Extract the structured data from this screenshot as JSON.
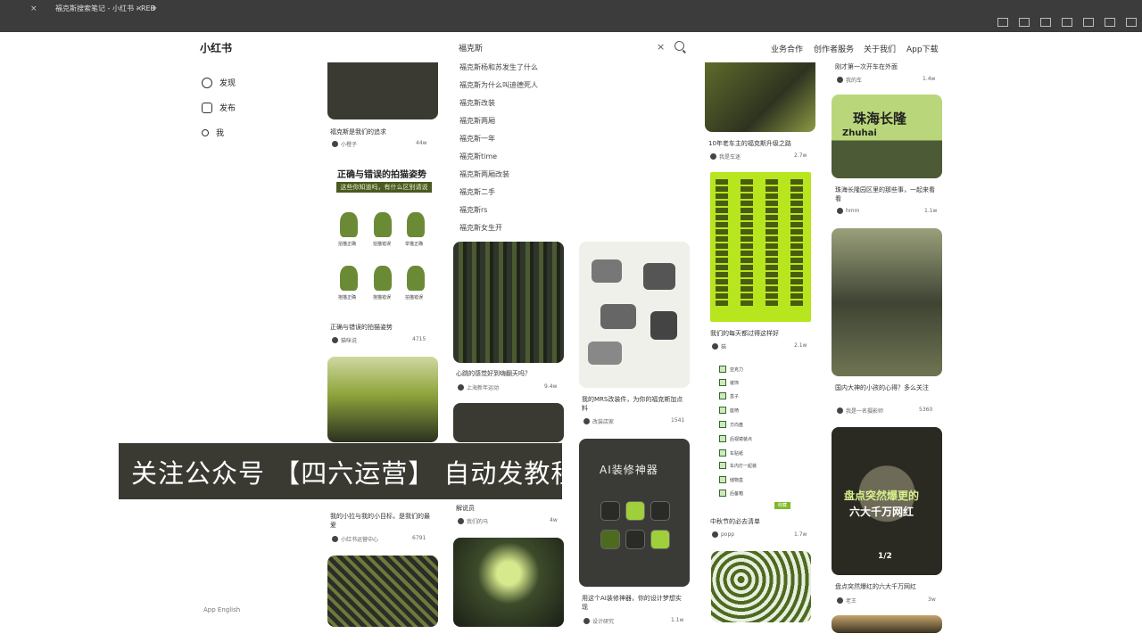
{
  "browser": {
    "tabs": [
      {
        "label": "福克斯搜索笔记 - 小红书 - RED"
      }
    ],
    "new_tab": "+",
    "tab_close": "×"
  },
  "header": {
    "logo": "小红书",
    "search_value": "福克斯",
    "search_clear": "×",
    "nav": [
      "业务合作",
      "创作者服务",
      "关于我们",
      "App下载"
    ]
  },
  "sidebar": {
    "items": [
      {
        "label": "发现",
        "icon": "compass-icon"
      },
      {
        "label": "发布",
        "icon": "plus-square-icon"
      },
      {
        "label": "我",
        "icon": "user-icon"
      }
    ],
    "footer": "App  English"
  },
  "suggestions": [
    "福克斯杨和苏发生了什么",
    "福克斯为什么叫迪德死人",
    "福克斯改装",
    "福克斯两厢",
    "福克斯一年",
    "福克斯time",
    "福克斯两厢改装",
    "福克斯二手",
    "福克斯rs",
    "福克斯女生开"
  ],
  "cards": {
    "c1": {
      "caption": "福克斯是我们的追求",
      "author": "小橙子",
      "likes": "44w"
    },
    "c2": {
      "caption": "正确与错误的拍猫姿势",
      "author": "猫咪说",
      "likes": "4715",
      "title": "正确与错误的拍猫姿势",
      "subtitle": "这些你知道吗，有什么区别请说"
    },
    "c3": {
      "caption": "我的小拉与我的小目标，是我们的最爱",
      "author": "小红书运营中心",
      "likes": "6791"
    },
    "c4": {
      "caption": "心跳的感觉好到嗨翻天吗？",
      "author": "上海新年运动",
      "likes": "9.4w"
    },
    "c5": {
      "caption": "解说员",
      "author": "我们的马",
      "likes": "4w"
    },
    "c6": {
      "caption": "我的MRS改装件，为你的福克斯加点料",
      "author": "改装店家",
      "likes": "1541"
    },
    "c7": {
      "caption": "用这个AI装修神器，你的设计梦想实现",
      "author": "设计研究",
      "likes": "1.1w",
      "title": "AI装修神器"
    },
    "c8": {
      "caption": "10年老车主的福克斯升级之路",
      "author": "我是车迷",
      "likes": "2.7w"
    },
    "c9": {
      "caption": "我们的每天都过得这样好",
      "author": "猫",
      "likes": "2.1w"
    },
    "c10": {
      "caption": "中秋节的必去清单",
      "author": "popp",
      "likes": "1.7w",
      "badge": "收藏"
    },
    "c11": {
      "caption": "刚才第一次开车在外面",
      "author": "我的车",
      "likes": "1.4w"
    },
    "c12": {
      "caption": "珠海长隆园区里的那些事，一起来看看",
      "author": "hmm",
      "likes": "1.1w",
      "sign_cn": "珠海长隆",
      "sign_en": "Zhuhai"
    },
    "c13": {
      "caption": "国内大神的小孩的心得？多么关注",
      "author": "我是一名摄影师",
      "likes": "5360"
    },
    "c14": {
      "caption": "盘点突然爆红的六大千万网红",
      "author": "老王",
      "likes": "3w",
      "title_line1": "盘点突然爆更的",
      "title_line2": "六大千万网红",
      "tag": "1/2"
    }
  },
  "pose_labels": [
    "拍猫正确",
    "拍猫错误",
    "举猫正确",
    "抱猫正确",
    "抱猫错误",
    "拍猫错误"
  ],
  "checklist": [
    "亚克力",
    "装饰",
    "盒子",
    "座椅",
    "方向盘",
    "后视镜装点",
    "车贴纸",
    "车内灯一起装",
    "储物盒",
    "后备箱"
  ],
  "overlay": {
    "banner": "关注公众号 【四六运营】 自动发教程"
  },
  "colors": {
    "chrome": "#3c3c3c",
    "accent_lime": "#b7e61e",
    "banner_bg": "#3a3a33"
  }
}
